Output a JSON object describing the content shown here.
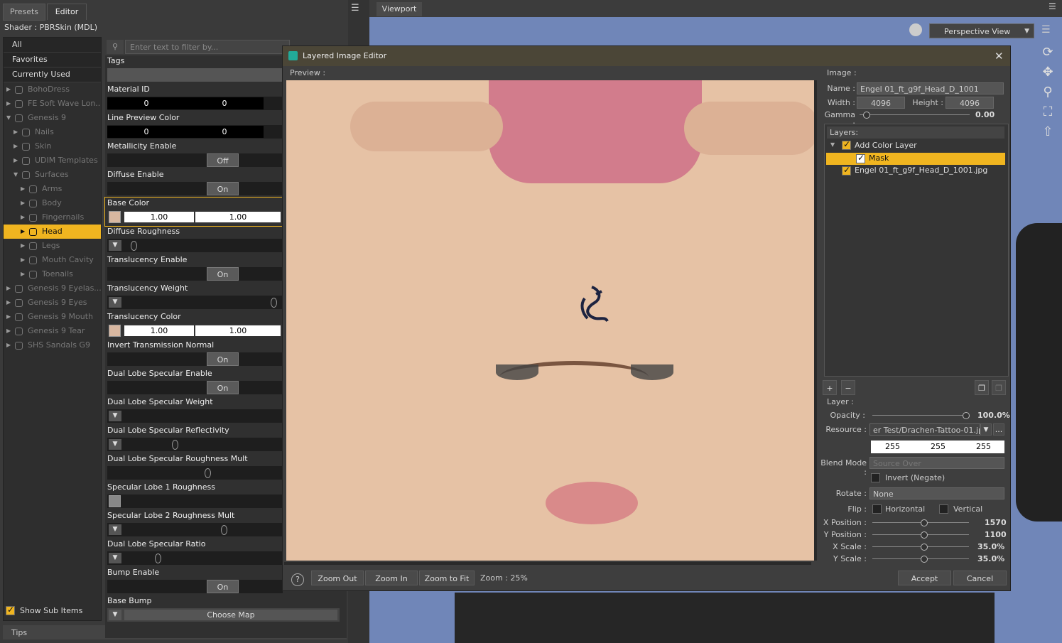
{
  "tabs": {
    "presets": "Presets",
    "editor": "Editor"
  },
  "shader_label": "Shader :  PBRSkin (MDL)",
  "filter_placeholder": "Enter text to filter by...",
  "categories": [
    "All",
    "Favorites",
    "Currently Used"
  ],
  "tree": [
    {
      "label": "BohoDress"
    },
    {
      "label": "FE Soft Wave Lon..."
    },
    {
      "label": "Genesis 9"
    },
    {
      "label": "Nails"
    },
    {
      "label": "Skin"
    },
    {
      "label": "UDIM Templates"
    },
    {
      "label": "Surfaces"
    },
    {
      "label": "Arms"
    },
    {
      "label": "Body"
    },
    {
      "label": "Fingernails"
    },
    {
      "label": "Head"
    },
    {
      "label": "Legs"
    },
    {
      "label": "Mouth Cavity"
    },
    {
      "label": "Toenails"
    },
    {
      "label": "Genesis 9 Eyelas..."
    },
    {
      "label": "Genesis 9 Eyes"
    },
    {
      "label": "Genesis 9 Mouth"
    },
    {
      "label": "Genesis 9 Tear"
    },
    {
      "label": "SHS Sandals G9"
    }
  ],
  "show_sub_items": "Show Sub Items",
  "tips": "Tips",
  "props": {
    "tags": "Tags",
    "material_id": {
      "label": "Material ID",
      "v1": "0",
      "v2": "0"
    },
    "line_preview": {
      "label": "Line Preview Color",
      "v1": "0",
      "v2": "0"
    },
    "metallicity": {
      "label": "Metallicity Enable",
      "state": "Off"
    },
    "diffuse_enable": {
      "label": "Diffuse Enable",
      "state": "On"
    },
    "base_color": {
      "label": "Base Color",
      "v1": "1.00",
      "v2": "1.00"
    },
    "diffuse_rough": {
      "label": "Diffuse Roughness"
    },
    "transl_enable": {
      "label": "Translucency Enable",
      "state": "On"
    },
    "transl_weight": {
      "label": "Translucency Weight"
    },
    "transl_color": {
      "label": "Translucency Color",
      "v1": "1.00",
      "v2": "1.00"
    },
    "invert_trans": {
      "label": "Invert Transmission Normal",
      "state": "On"
    },
    "dual_enable": {
      "label": "Dual Lobe Specular Enable",
      "state": "On"
    },
    "dual_weight": {
      "label": "Dual Lobe Specular Weight"
    },
    "dual_refl": {
      "label": "Dual Lobe Specular Reflectivity"
    },
    "dual_rough": {
      "label": "Dual Lobe Specular Roughness Mult"
    },
    "spec1": {
      "label": "Specular Lobe 1 Roughness"
    },
    "spec2": {
      "label": "Specular Lobe 2 Roughness Mult"
    },
    "dual_ratio": {
      "label": "Dual Lobe Specular Ratio"
    },
    "bump_enable": {
      "label": "Bump Enable",
      "state": "On"
    },
    "base_bump": {
      "label": "Base Bump",
      "choose": "Choose Map"
    }
  },
  "viewport": {
    "tab": "Viewport",
    "view": "Perspective View"
  },
  "dialog": {
    "title": "Layered Image Editor",
    "preview_label": "Preview :",
    "image_label": "Image :",
    "name_label": "Name :",
    "name_value": "Engel 01_ft_g9f_Head_D_1001",
    "width_label": "Width :",
    "width_value": "4096",
    "height_label": "Height :",
    "height_value": "4096",
    "gamma_label": "Gamma :",
    "gamma_value": "0.00",
    "layers_label": "Layers:",
    "layers": [
      "Add Color Layer",
      "Mask",
      "Engel 01_ft_g9f_Head_D_1001.jpg"
    ],
    "layer_label": "Layer :",
    "opacity_label": "Opacity :",
    "opacity_value": "100.0%",
    "resource_label": "Resource :",
    "resource_value": "er Test/Drachen-Tattoo-01.jpg",
    "rgb": [
      "255",
      "255",
      "255"
    ],
    "blend_label": "Blend Mode :",
    "blend_value": "Source Over",
    "invert_label": "Invert (Negate)",
    "rotate_label": "Rotate :",
    "rotate_value": "None",
    "flip_label": "Flip :",
    "flip_h": "Horizontal",
    "flip_v": "Vertical",
    "xpos_label": "X Position :",
    "xpos_value": "1570",
    "ypos_label": "Y Position :",
    "ypos_value": "1100",
    "xscale_label": "X Scale :",
    "xscale_value": "35.0%",
    "yscale_label": "Y Scale :",
    "yscale_value": "35.0%",
    "zoom_out": "Zoom Out",
    "zoom_in": "Zoom In",
    "zoom_fit": "Zoom to Fit",
    "zoom_level": "Zoom : 25%",
    "accept": "Accept",
    "cancel": "Cancel"
  },
  "colors": {
    "accent": "#f0b520",
    "viewport_bg": "#7086b8",
    "skin": "#e6c2a5"
  }
}
